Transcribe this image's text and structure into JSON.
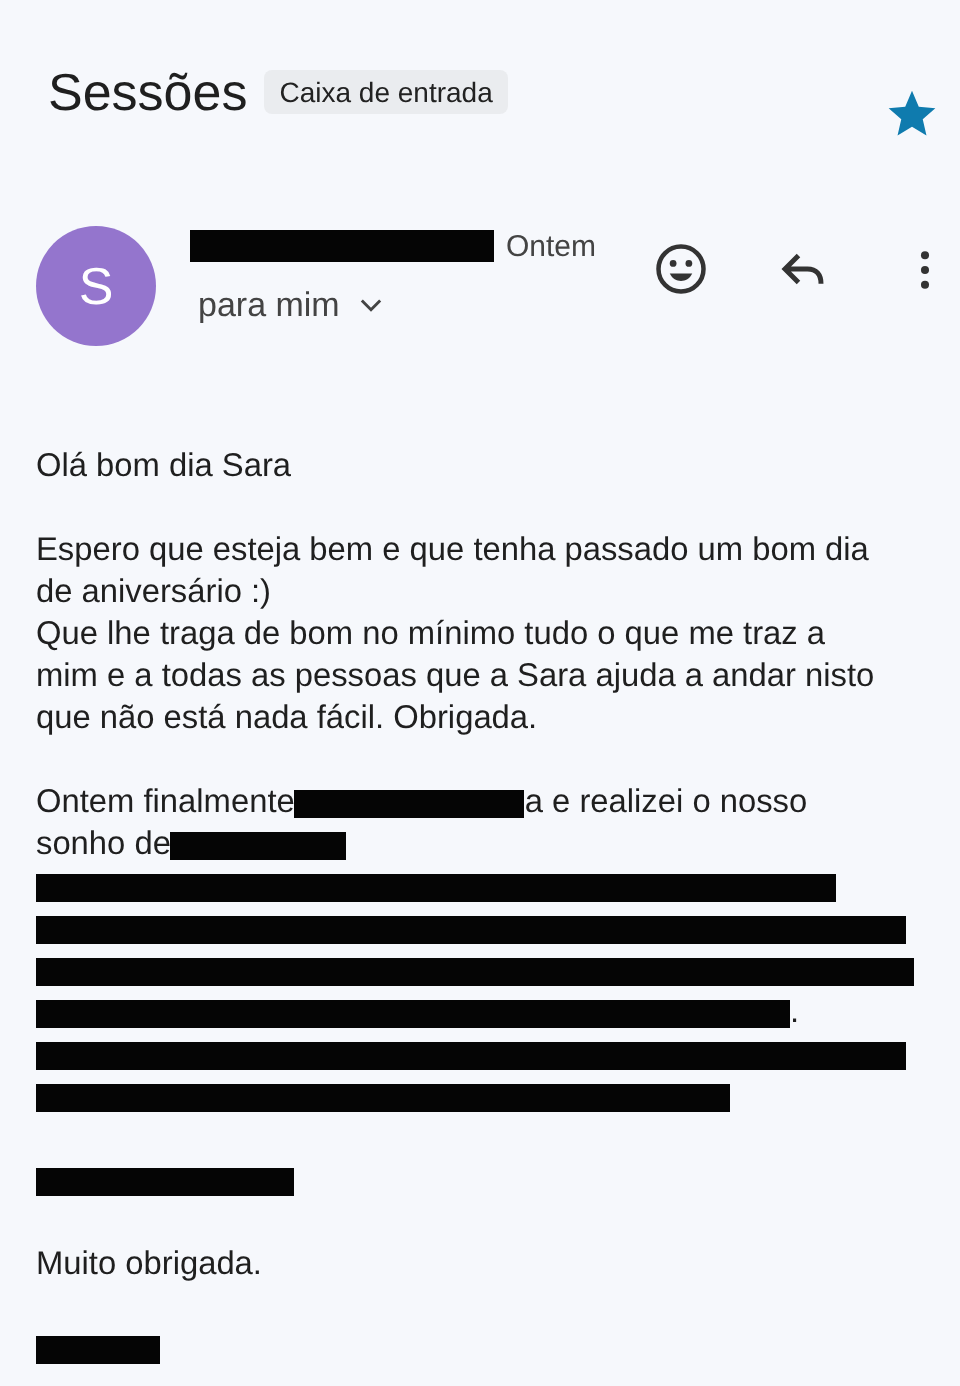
{
  "header": {
    "title": "Sessões",
    "label": "Caixa de entrada",
    "starred": true
  },
  "message": {
    "avatar_letter": "S",
    "sender": {
      "kind": "redacted"
    },
    "date": "Ontem",
    "recipient": "para mim"
  },
  "body": [
    {
      "lines": [
        [
          {
            "kind": "text",
            "text": "Olá bom dia Sara"
          }
        ]
      ]
    },
    {
      "lines": [
        [
          {
            "kind": "text",
            "text": "Espero que esteja bem e que tenha passado um bom dia"
          }
        ],
        [
          {
            "kind": "text",
            "text": "de aniversário :)"
          }
        ],
        [
          {
            "kind": "text",
            "text": "Que lhe traga de bom no mínimo tudo o que me traz a"
          }
        ],
        [
          {
            "kind": "text",
            "text": "mim e a todas as pessoas que a Sara ajuda a andar nisto"
          }
        ],
        [
          {
            "kind": "text",
            "text": "que não está nada fácil. Obrigada."
          }
        ]
      ]
    },
    {
      "lines": [
        [
          {
            "kind": "text",
            "text": "Ontem finalmente "
          },
          {
            "kind": "redacted"
          },
          {
            "kind": "text",
            "text": "a e realizei o nosso"
          }
        ],
        [
          {
            "kind": "text",
            "text": "sonho de "
          },
          {
            "kind": "redacted"
          }
        ],
        [
          {
            "kind": "redacted"
          }
        ],
        [
          {
            "kind": "redacted"
          }
        ],
        [
          {
            "kind": "redacted"
          }
        ],
        [
          {
            "kind": "redacted"
          },
          {
            "kind": "text",
            "text": "."
          }
        ],
        [
          {
            "kind": "redacted"
          }
        ],
        [
          {
            "kind": "redacted"
          }
        ]
      ]
    },
    {
      "lines": [
        [
          {
            "kind": "redacted"
          }
        ]
      ]
    },
    {
      "lines": [
        [
          {
            "kind": "text",
            "text": "Muito obrigada."
          }
        ]
      ]
    },
    {
      "lines": [
        [
          {
            "kind": "redacted"
          }
        ]
      ]
    }
  ]
}
